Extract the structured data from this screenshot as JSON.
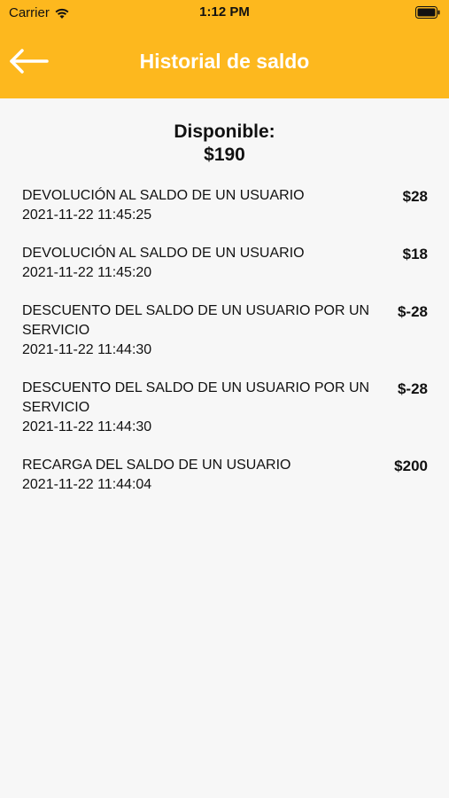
{
  "status": {
    "carrier": "Carrier",
    "time": "1:12 PM"
  },
  "header": {
    "title": "Historial de saldo",
    "back_icon": "arrow-left-icon",
    "color": "#fdb81e"
  },
  "summary": {
    "label": "Disponible:",
    "amount": "$190"
  },
  "transactions": [
    {
      "description": "DEVOLUCIÓN AL SALDO DE UN USUARIO",
      "date": "2021-11-22 11:45:25",
      "amount": "$28"
    },
    {
      "description": "DEVOLUCIÓN AL SALDO DE UN USUARIO",
      "date": "2021-11-22 11:45:20",
      "amount": "$18"
    },
    {
      "description": "DESCUENTO DEL SALDO DE UN USUARIO POR UN SERVICIO",
      "date": "2021-11-22 11:44:30",
      "amount": "$-28"
    },
    {
      "description": "DESCUENTO DEL SALDO DE UN USUARIO POR UN SERVICIO",
      "date": "2021-11-22 11:44:30",
      "amount": "$-28"
    },
    {
      "description": "RECARGA DEL SALDO DE UN USUARIO",
      "date": "2021-11-22 11:44:04",
      "amount": "$200"
    }
  ]
}
